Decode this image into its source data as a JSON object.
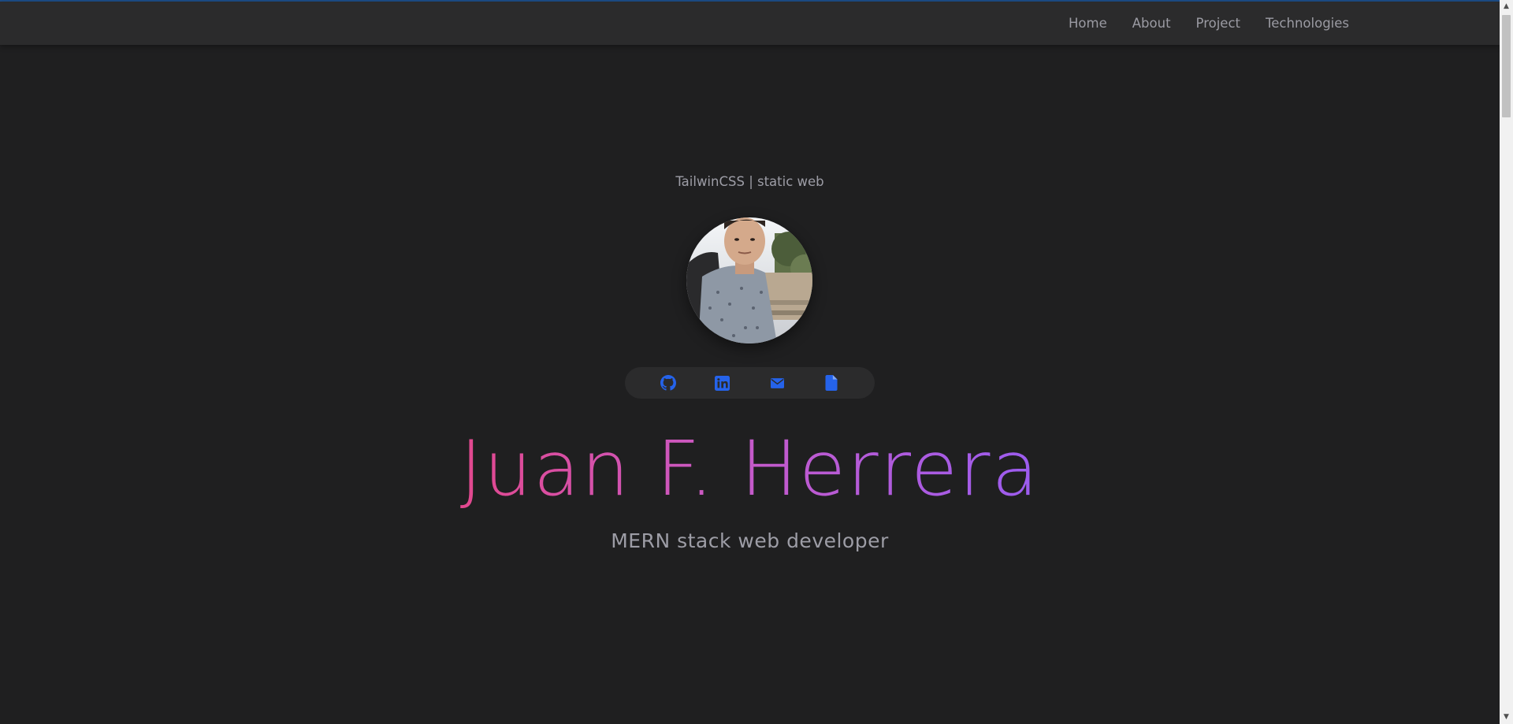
{
  "nav": {
    "items": [
      "Home",
      "About",
      "Project",
      "Technologies"
    ]
  },
  "hero": {
    "subtitle": "TailwinCSS | static web",
    "name": "Juan F. Herrera",
    "role": "MERN stack web developer"
  },
  "social": {
    "icons": [
      "github-icon",
      "linkedin-icon",
      "email-icon",
      "document-icon"
    ],
    "icon_color": "#2563eb"
  },
  "colors": {
    "background": "#1f1f20",
    "navbar": "#2b2b2c",
    "gradient_start": "#e2488e",
    "gradient_end": "#9b5cf0",
    "muted_text": "#9d9da6"
  }
}
